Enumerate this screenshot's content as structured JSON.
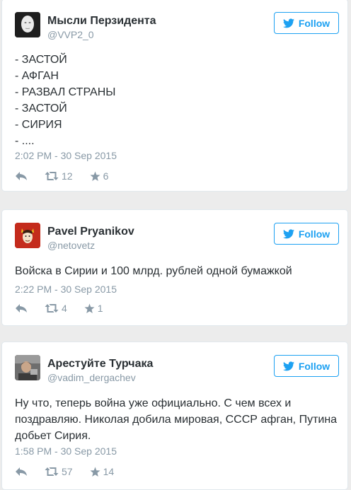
{
  "follow_label": "Follow",
  "colors": {
    "accent": "#1da1f2",
    "muted": "#8899a6",
    "text": "#292f33"
  },
  "tweets": [
    {
      "name": "Мысли Перзидента",
      "handle": "@VVP2_0",
      "lines": [
        "- ЗАСТОЙ",
        "- АФГАН",
        "- РАЗВАЛ СТРАНЫ",
        "- ЗАСТОЙ",
        "- СИРИЯ",
        "- ...."
      ],
      "time": "2:02 PM - 30 Sep 2015",
      "retweets": "12",
      "favorites": "6"
    },
    {
      "name": "Pavel Pryanikov",
      "handle": "@netovetz",
      "lines": [
        "Войска в Сирии и 100 млрд. рублей одной бумажкой"
      ],
      "time": "2:22 PM - 30 Sep 2015",
      "retweets": "4",
      "favorites": "1"
    },
    {
      "name": "Арестуйте Турчака",
      "handle": "@vadim_dergachev",
      "lines": [
        "Ну что, теперь война уже официально. С чем всех и",
        "поздравляю. Николая добила мировая, СССР афган, Путина",
        "добьет Сирия."
      ],
      "time": "1:58 PM - 30 Sep 2015",
      "retweets": "57",
      "favorites": "14"
    }
  ]
}
